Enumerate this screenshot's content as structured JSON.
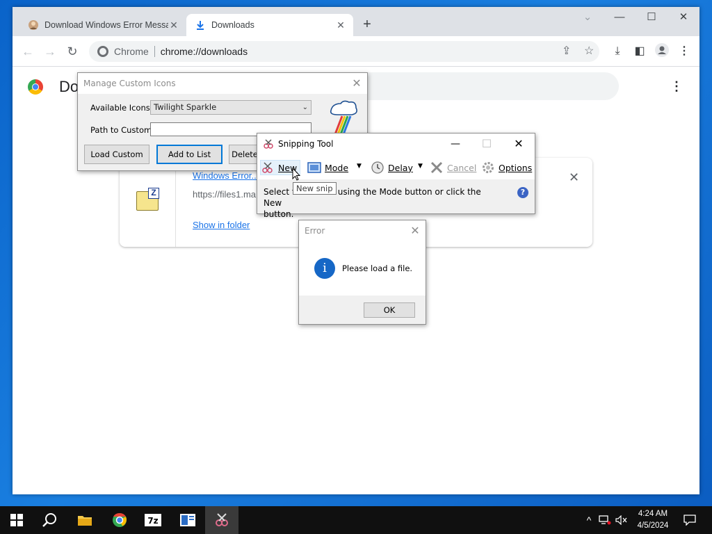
{
  "browser": {
    "tabs": [
      {
        "title": "Download Windows Error Messag",
        "icon": "person-favicon-icon"
      },
      {
        "title": "Downloads",
        "icon": "download-icon"
      }
    ],
    "new_tab_label": "+",
    "omnibox": {
      "chip": "Chrome",
      "url": "chrome://downloads"
    }
  },
  "page": {
    "title": "Do",
    "download_item": {
      "name": "Windows Error...",
      "url": "https://files1.ma",
      "more": "...",
      "show_in_folder": "Show in folder"
    }
  },
  "manage_icons": {
    "title": "Manage Custom Icons",
    "available_label": "Available Icons:",
    "available_value": "Twilight Sparkle",
    "path_label": "Path to Custom:",
    "path_value": "",
    "buttons": {
      "load": "Load Custom",
      "add": "Add to List",
      "delete": "Delete"
    }
  },
  "snipping": {
    "title": "Snipping Tool",
    "toolbar": {
      "new": "New",
      "mode": "Mode",
      "delay": "Delay",
      "cancel": "Cancel",
      "options": "Options"
    },
    "message_a": "Select t",
    "message_b": "e using the Mode button or click the New",
    "message_c": "button.",
    "tooltip": "New snip"
  },
  "error_dialog": {
    "title": "Error",
    "message": "Please load a file.",
    "ok": "OK"
  },
  "taskbar": {
    "time": "4:24 AM",
    "date": "4/5/2024",
    "apps": [
      "start-icon",
      "search-icon",
      "file-explorer-icon",
      "chrome-icon",
      "7zip-icon",
      "app-icon",
      "snipping-tool-icon"
    ]
  },
  "colors": {
    "accent": "#0078d7",
    "link": "#1a73e8",
    "desktop": "#1a7fe0"
  }
}
